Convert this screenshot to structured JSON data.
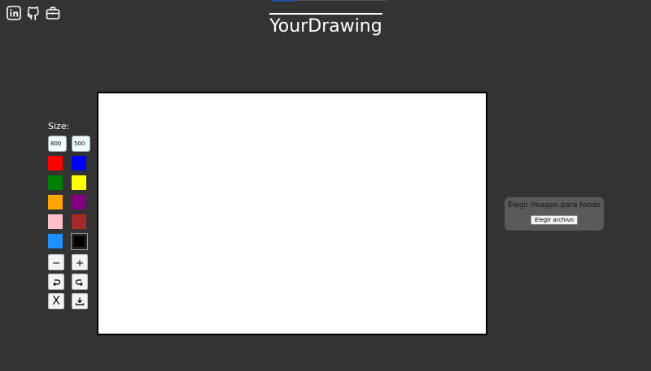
{
  "social": {
    "icons": [
      "linkedin-icon",
      "github-icon",
      "briefcase-icon"
    ]
  },
  "header": {
    "title": "YourDrawing"
  },
  "size": {
    "label": "Size:",
    "width": "800",
    "height": "500"
  },
  "palette": {
    "colors": [
      "#ff0000",
      "#0000ff",
      "#008000",
      "#ffff00",
      "#ffa500",
      "#800080",
      "#ffc0cb",
      "#a52a2a",
      "#1e90ff",
      "#000000"
    ]
  },
  "tools": {
    "clear_label": "X"
  },
  "background_picker": {
    "label": "Elegir imagen para fondo",
    "button_label": "Elegir archivo"
  }
}
